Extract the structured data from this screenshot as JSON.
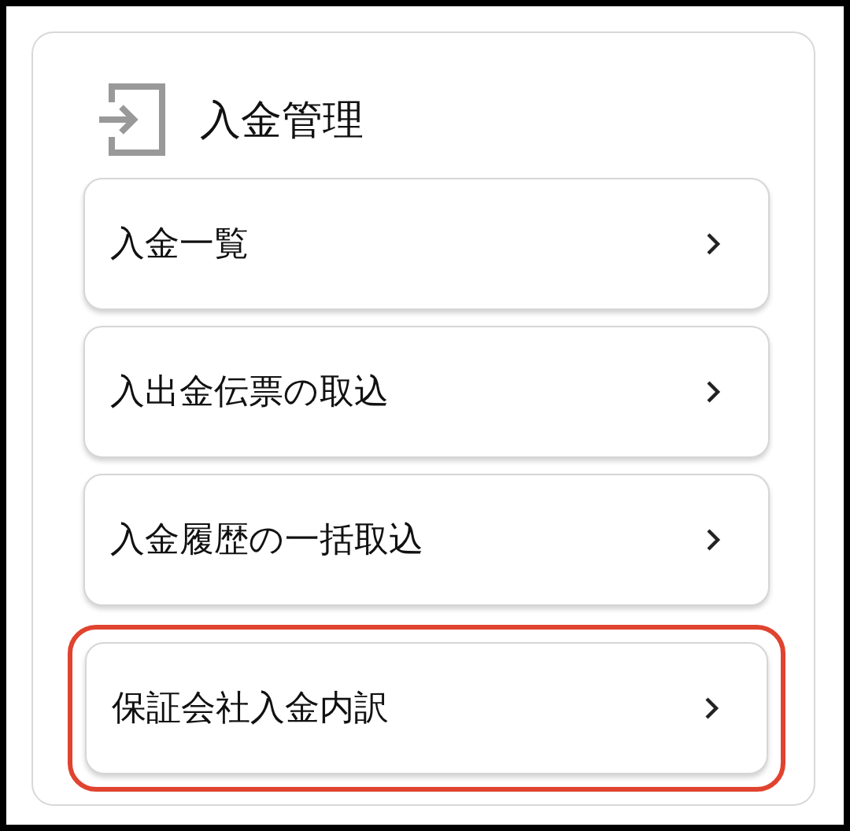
{
  "panel": {
    "title": "入金管理"
  },
  "menu_items": [
    {
      "label": "入金一覧",
      "highlighted": false
    },
    {
      "label": "入出金伝票の取込",
      "highlighted": false
    },
    {
      "label": "入金履歴の一括取込",
      "highlighted": false
    },
    {
      "label": "保証会社入金内訳",
      "highlighted": true
    }
  ]
}
